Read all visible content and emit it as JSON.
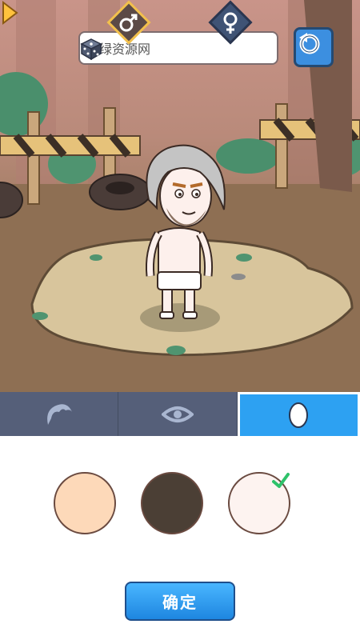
{
  "name_input": {
    "value": "新绿资源网"
  },
  "icons": {
    "dice": "dice-icon",
    "reset": "refresh-icon",
    "next": "arrow-right-icon",
    "male": "male-symbol-icon",
    "female": "female-symbol-icon"
  },
  "tabs": [
    {
      "name": "hair",
      "icon": "hair-icon",
      "active": false
    },
    {
      "name": "eyes",
      "icon": "eye-icon",
      "active": false
    },
    {
      "name": "skin",
      "icon": "face-icon",
      "active": true
    }
  ],
  "skin_colors": [
    {
      "color": "#fdd9b9",
      "selected": false
    },
    {
      "color": "#4b3f35",
      "selected": false
    },
    {
      "color": "#fdf3f0",
      "selected": true
    }
  ],
  "confirm_button": {
    "label": "确定"
  },
  "colors": {
    "accent": "#2da1f2",
    "tab_bar": "#555f79",
    "check": "#2ec26a"
  }
}
